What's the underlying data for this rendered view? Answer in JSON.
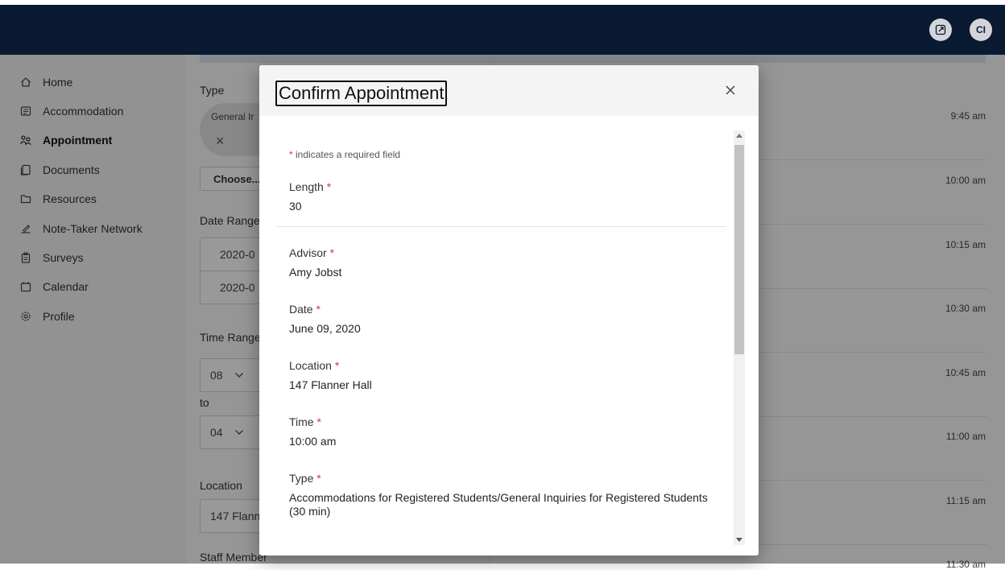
{
  "topbar": {
    "icons": [
      "external-link-icon"
    ],
    "avatar_initials": "CI"
  },
  "sidebar": {
    "items": [
      {
        "label": "Home",
        "icon": "home-icon"
      },
      {
        "label": "Accommodation",
        "icon": "list-icon"
      },
      {
        "label": "Appointment",
        "icon": "people-icon",
        "active": true
      },
      {
        "label": "Documents",
        "icon": "documents-icon"
      },
      {
        "label": "Resources",
        "icon": "folder-icon"
      },
      {
        "label": "Note-Taker Network",
        "icon": "pen-icon"
      },
      {
        "label": "Surveys",
        "icon": "clipboard-icon"
      },
      {
        "label": "Calendar",
        "icon": "calendar-icon"
      },
      {
        "label": "Profile",
        "icon": "gear-icon"
      }
    ]
  },
  "form": {
    "type_label": "Type",
    "chip_text": "General Ir",
    "chip_remove": "×",
    "choose_button": "Choose...",
    "date_range_label": "Date Range",
    "date_from": "2020-0",
    "date_to": "2020-0",
    "time_range_label": "Time Range",
    "time_from": "08",
    "time_to_word": "to",
    "time_to": "04",
    "location_label": "Location",
    "location_value": "147 Flann",
    "staff_label": "Staff Member"
  },
  "slots": [
    "9:45 am",
    "10:00 am",
    "10:15 am",
    "10:30 am",
    "10:45 am",
    "11:00 am",
    "11:15 am",
    "11:30 am"
  ],
  "modal": {
    "title": "Confirm Appointment",
    "close_label": "×",
    "required_star": "*",
    "required_note": "indicates a required field",
    "fields": [
      {
        "label": "Length",
        "value": "30"
      },
      {
        "label": "Advisor",
        "value": "Amy Jobst"
      },
      {
        "label": "Date",
        "value": "June 09, 2020"
      },
      {
        "label": "Location",
        "value": "147 Flanner Hall"
      },
      {
        "label": "Time",
        "value": "10:00 am"
      },
      {
        "label": "Type",
        "value": "Accommodations for Registered Students/General Inquiries for Registered Students (30 min)"
      }
    ]
  },
  "colors": {
    "topbar": "#0b1a33",
    "required": "#d9363e",
    "overlay": "rgba(0,0,0,0.40)"
  }
}
